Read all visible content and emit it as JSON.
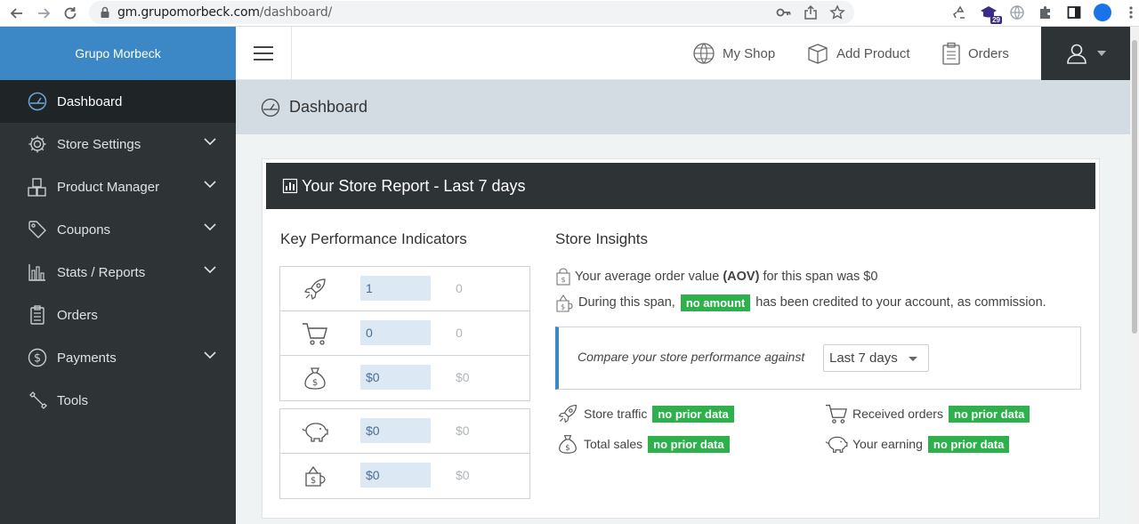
{
  "browser": {
    "url_host": "gm.grupomorbeck.com",
    "url_path": "/dashboard/",
    "extension_badge": "29"
  },
  "sidebar": {
    "brand": "Grupo Morbeck",
    "items": [
      {
        "label": "Dashboard",
        "icon": "dashboard-icon",
        "active": true,
        "has_children": false
      },
      {
        "label": "Store Settings",
        "icon": "gear-icon",
        "active": false,
        "has_children": true
      },
      {
        "label": "Product Manager",
        "icon": "boxes-icon",
        "active": false,
        "has_children": true
      },
      {
        "label": "Coupons",
        "icon": "tag-icon",
        "active": false,
        "has_children": true
      },
      {
        "label": "Stats / Reports",
        "icon": "bar-chart-icon",
        "active": false,
        "has_children": true
      },
      {
        "label": "Orders",
        "icon": "clipboard-icon",
        "active": false,
        "has_children": false
      },
      {
        "label": "Payments",
        "icon": "dollar-circle-icon",
        "active": false,
        "has_children": true
      },
      {
        "label": "Tools",
        "icon": "wrench-icon",
        "active": false,
        "has_children": false
      }
    ]
  },
  "header": {
    "my_shop": "My Shop",
    "add_product": "Add Product",
    "orders": "Orders"
  },
  "page": {
    "title": "Dashboard"
  },
  "report": {
    "title": "Your Store Report - Last 7 days",
    "kpi_heading": "Key Performance Indicators",
    "kpis_group1": [
      {
        "icon": "rocket-icon",
        "value": "1",
        "previous": "0"
      },
      {
        "icon": "cart-icon",
        "value": "0",
        "previous": "0"
      },
      {
        "icon": "money-bag-icon",
        "value": "$0",
        "previous": "$0"
      }
    ],
    "kpis_group2": [
      {
        "icon": "piggy-bank-icon",
        "value": "$0",
        "previous": "$0"
      },
      {
        "icon": "commission-icon",
        "value": "$0",
        "previous": "$0"
      }
    ],
    "insights_heading": "Store Insights",
    "aov_before": "Your average order value ",
    "aov_bold": "(AOV)",
    "aov_after": " for this span was $0",
    "commission_before": "During this span,",
    "commission_tag": "no amount",
    "commission_after": "has been credited to your account, as commission.",
    "compare_label": "Compare your store performance against",
    "compare_selected": "Last 7 days",
    "stats": [
      {
        "label": "Store traffic",
        "tag": "no prior data",
        "icon": "rocket-icon"
      },
      {
        "label": "Received orders",
        "tag": "no prior data",
        "icon": "cart-icon"
      },
      {
        "label": "Total sales",
        "tag": "no prior data",
        "icon": "money-bag-icon"
      },
      {
        "label": "Your earning",
        "tag": "no prior data",
        "icon": "piggy-bank-icon"
      }
    ]
  },
  "colors": {
    "sidebar_bg": "#2e3436",
    "brand_bg": "#3c88c6",
    "tag_green": "#2eb04c",
    "kpi_value_bg": "#dce8f3"
  }
}
